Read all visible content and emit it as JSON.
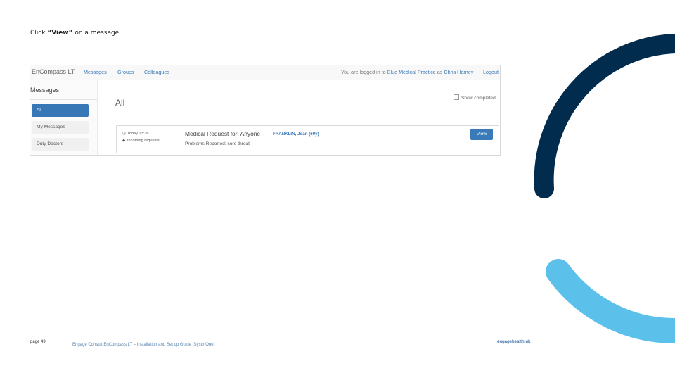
{
  "instruction": {
    "prefix": "Click ",
    "action": "“View”",
    "suffix": " on a message"
  },
  "app": {
    "brand": "EnCompass LT",
    "nav": [
      "Messages",
      "Groups",
      "Colleagues"
    ],
    "login": {
      "prefix": "You are logged in to ",
      "practice": "Blue Medical Practice",
      "middle": " as ",
      "user": "Chris Harney"
    },
    "logout": "Logout",
    "sidebar": {
      "title": "Messages",
      "items": [
        "All",
        "My Messages",
        "Duty Doctors"
      ]
    },
    "main": {
      "heading": "All",
      "show_completed": "Show completed",
      "message": {
        "time": "Today 13:36",
        "tag": "Incoming requests",
        "title": "Medical Request for: Anyone",
        "patient": "FRANKLIN, Joan (60y)",
        "problem": "Problems Reported: sore throat",
        "view_label": "View"
      }
    }
  },
  "footer": {
    "page": "page 49",
    "doc": "Engage Consult EnCompass LT – Installation and Set up Guide (SystmOne)",
    "site": "engagehealth.uk"
  },
  "colors": {
    "navy_arc": "#012c4e",
    "sky_arc": "#5bc1ea",
    "accent": "#3877b5"
  },
  "icons": [
    "clock-icon",
    "tag-icon",
    "checkbox-icon"
  ]
}
